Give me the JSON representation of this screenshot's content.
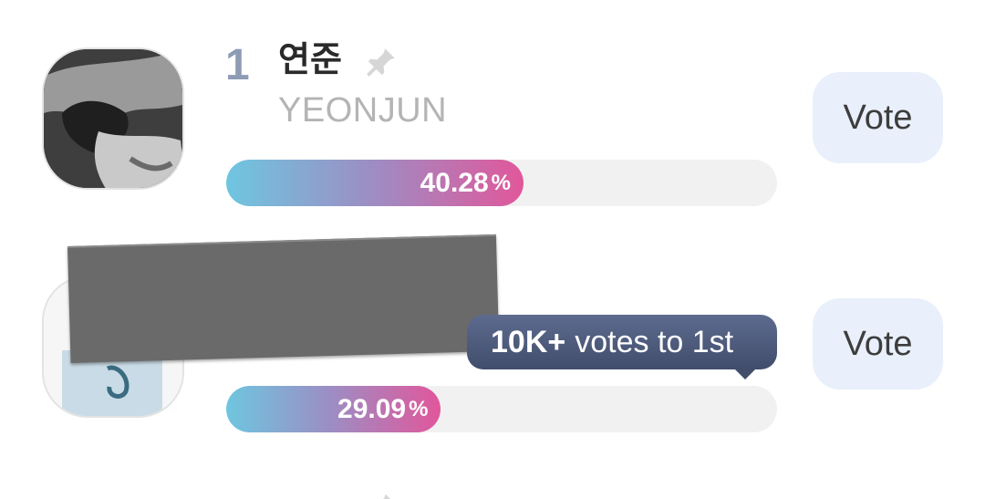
{
  "candidates": [
    {
      "rank": "1",
      "name_ko": "연준",
      "name_en": "YEONJUN",
      "percent": "40.28",
      "percent_symbol": "%",
      "share": 0.4028,
      "vote_label": "Vote",
      "avatar_icon": "member-photo"
    },
    {
      "rank": "",
      "name_ko": "",
      "name_en": "",
      "percent": "29.09",
      "percent_symbol": "%",
      "share": 0.2909,
      "vote_label": "Vote",
      "avatar_icon": "member-photo",
      "tooltip": {
        "bold": "10K+",
        "text": "votes to 1st"
      }
    }
  ],
  "icons": {
    "pin": "pin-icon"
  },
  "colors": {
    "rank": "#8e9bb4",
    "bar_start": "#6ec6e0",
    "bar_end": "#e1579b",
    "vote_bg": "#e9f0fb",
    "tooltip_bg": "#4b5778"
  }
}
